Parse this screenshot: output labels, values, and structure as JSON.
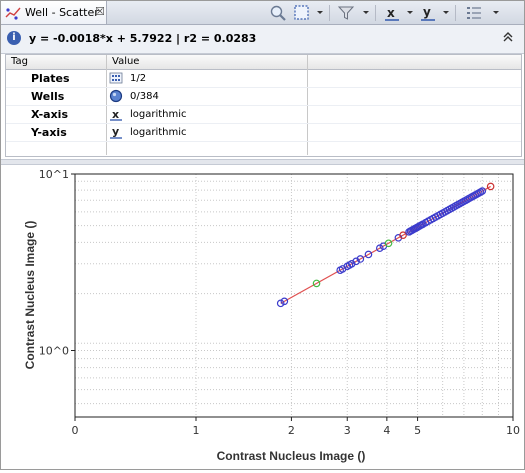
{
  "tab": {
    "title": "Well - Scatter",
    "close": "☒"
  },
  "toolbar": {
    "buttons": [
      "zoom",
      "select-rect",
      "filter",
      "x-axis",
      "y-axis",
      "view-menu"
    ],
    "x_label": "x",
    "y_label": "y"
  },
  "info": {
    "icon": "i",
    "text": "y = -0.0018*x + 5.7922 | r2 = 0.0283"
  },
  "table": {
    "headers": [
      "Tag",
      "Value"
    ],
    "rows": [
      {
        "tag": "Plates",
        "icon": "plates-icon",
        "value": "1/2"
      },
      {
        "tag": "Wells",
        "icon": "wells-icon",
        "value": "0/384"
      },
      {
        "tag": "X-axis",
        "icon": "x-axis-icon",
        "value": "logarithmic"
      },
      {
        "tag": "Y-axis",
        "icon": "y-axis-icon",
        "value": "logarithmic"
      }
    ]
  },
  "chart_data": {
    "type": "scatter",
    "xlabel": "Contrast Nucleus Image ()",
    "ylabel": "Contrast Nucleus Image ()",
    "x_scale": "log",
    "y_scale": "log",
    "x_ticks": [
      {
        "label": "0",
        "value": 0
      },
      {
        "label": "1",
        "value": 1
      },
      {
        "label": "2",
        "value": 2
      },
      {
        "label": "3",
        "value": 3
      },
      {
        "label": "4",
        "value": 4
      },
      {
        "label": "5",
        "value": 5
      },
      {
        "label": "10",
        "value": 10
      }
    ],
    "y_ticks": [
      {
        "label": "10^0",
        "value": 1
      },
      {
        "label": "10^1",
        "value": 10
      }
    ],
    "ylim": [
      0.42,
      10
    ],
    "grid": true,
    "legend": "none",
    "regression": {
      "x": [
        1.85,
        8.5
      ],
      "y": [
        1.85,
        8.5
      ],
      "color": "#e05050"
    },
    "points": {
      "marker_color": "#3c3ccc",
      "x": [
        1.85,
        1.9,
        2.4,
        2.85,
        2.9,
        3.0,
        3.05,
        3.1,
        3.2,
        3.3,
        3.5,
        3.8,
        3.9,
        4.05,
        4.35,
        4.5,
        4.7,
        4.75,
        4.8,
        4.85,
        4.9,
        4.95,
        5.0,
        5.05,
        5.1,
        5.15,
        5.2,
        5.3,
        5.4,
        5.5,
        5.6,
        5.7,
        5.8,
        5.9,
        6.0,
        6.1,
        6.2,
        6.3,
        6.4,
        6.5,
        6.6,
        6.7,
        6.8,
        6.9,
        7.0,
        7.1,
        7.2,
        7.3,
        7.4,
        7.5,
        7.6,
        7.7,
        7.8,
        7.9,
        8.0,
        8.5
      ],
      "y": [
        1.85,
        1.9,
        2.4,
        2.85,
        2.9,
        3.0,
        3.05,
        3.1,
        3.2,
        3.3,
        3.5,
        3.8,
        3.9,
        4.05,
        4.35,
        4.5,
        4.7,
        4.75,
        4.8,
        4.85,
        4.9,
        4.95,
        5.0,
        5.05,
        5.1,
        5.15,
        5.2,
        5.3,
        5.4,
        5.5,
        5.6,
        5.7,
        5.8,
        5.9,
        6.0,
        6.1,
        6.2,
        6.3,
        6.4,
        6.5,
        6.6,
        6.7,
        6.8,
        6.9,
        7.0,
        7.1,
        7.2,
        7.3,
        7.4,
        7.5,
        7.6,
        7.7,
        7.8,
        7.9,
        8.0,
        8.5
      ],
      "colors": {
        "2.4": "#44bb44",
        "4.05": "#44bb44",
        "4.5": "#cc3333",
        "8.5": "#cc3333"
      }
    }
  }
}
